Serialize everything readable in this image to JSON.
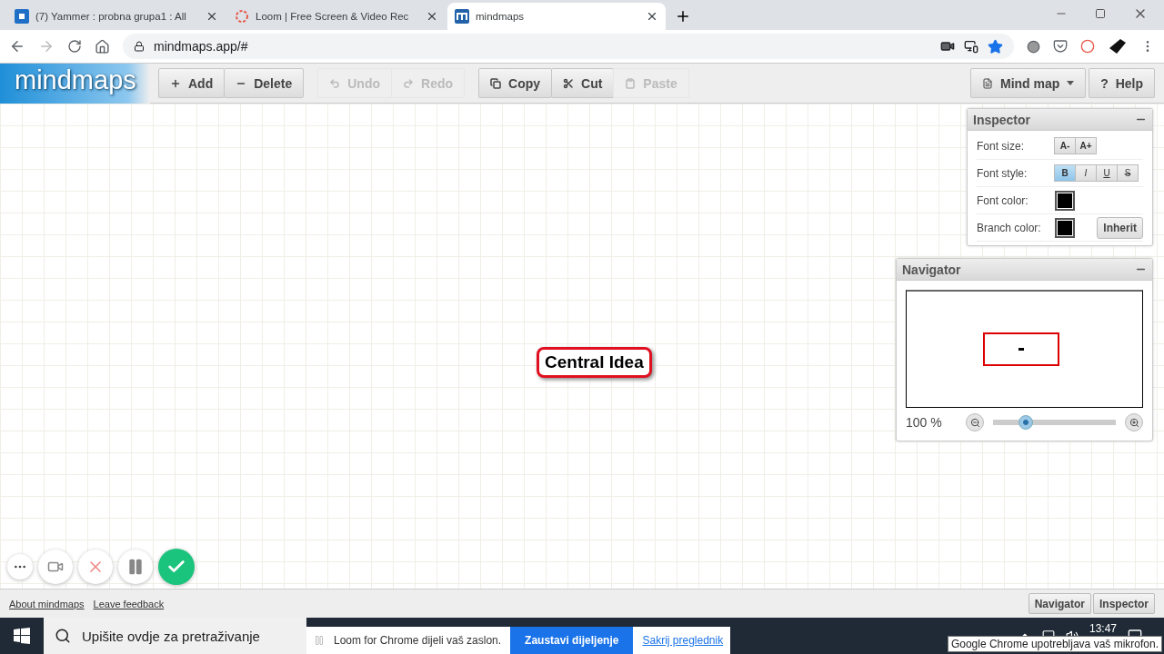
{
  "browser": {
    "tabs": [
      {
        "title": "(7) Yammer : probna grupa1 : All",
        "kind": "yammer",
        "selected": false
      },
      {
        "title": "Loom | Free Screen & Video Rec",
        "kind": "loom",
        "selected": false
      },
      {
        "title": "mindmaps",
        "kind": "mindmaps",
        "selected": true
      }
    ],
    "address": "mindmaps.app/#"
  },
  "app": {
    "logo": "mindmaps",
    "toolbar": [
      [
        {
          "label": "Add",
          "disabled": false
        },
        {
          "label": "Delete",
          "disabled": false
        }
      ],
      [
        {
          "label": "Undo",
          "disabled": true
        },
        {
          "label": "Redo",
          "disabled": true
        }
      ],
      [
        {
          "label": "Copy",
          "disabled": false
        },
        {
          "label": "Cut",
          "disabled": false
        },
        {
          "label": "Paste",
          "disabled": true
        }
      ]
    ],
    "menu_button": {
      "label": "Mind map"
    },
    "help_button": {
      "glyph": "?",
      "label": "Help"
    },
    "central_node": "Central Idea",
    "inspector": {
      "title": "Inspector",
      "rows": [
        {
          "label": "Font size:",
          "kind": "buttons",
          "buttons": [
            {
              "label": "A-",
              "selected": false
            },
            {
              "label": "A+",
              "selected": false
            }
          ]
        },
        {
          "label": "Font style:",
          "kind": "buttons",
          "buttons": [
            {
              "label": "B",
              "selected": true
            },
            {
              "label": "I",
              "selected": false
            },
            {
              "label": "U",
              "selected": false
            },
            {
              "label": "S",
              "selected": false
            }
          ]
        },
        {
          "label": "Font color:",
          "kind": "swatch",
          "color": "#000000"
        },
        {
          "label": "Branch color:",
          "kind": "swatch",
          "color": "#000000",
          "button": "Inherit"
        }
      ]
    },
    "navigator": {
      "title": "Navigator",
      "zoom": "100 %",
      "level": 0.27
    },
    "footer": {
      "links": [
        "About mindmaps",
        "Leave feedback"
      ],
      "buttons": [
        "Navigator",
        "Inspector"
      ]
    }
  },
  "taskbar": {
    "search_placeholder": "Upišite ovdje za pretraživanje",
    "share_bar": {
      "message": "Loom for Chrome dijeli vaš zaslon.",
      "stop_button": "Zaustavi dijeljenje",
      "hide_link": "Sakrij preglednik"
    },
    "clock": "13:47",
    "tooltip": "Google Chrome upotrebljava vaš mikrofon."
  }
}
